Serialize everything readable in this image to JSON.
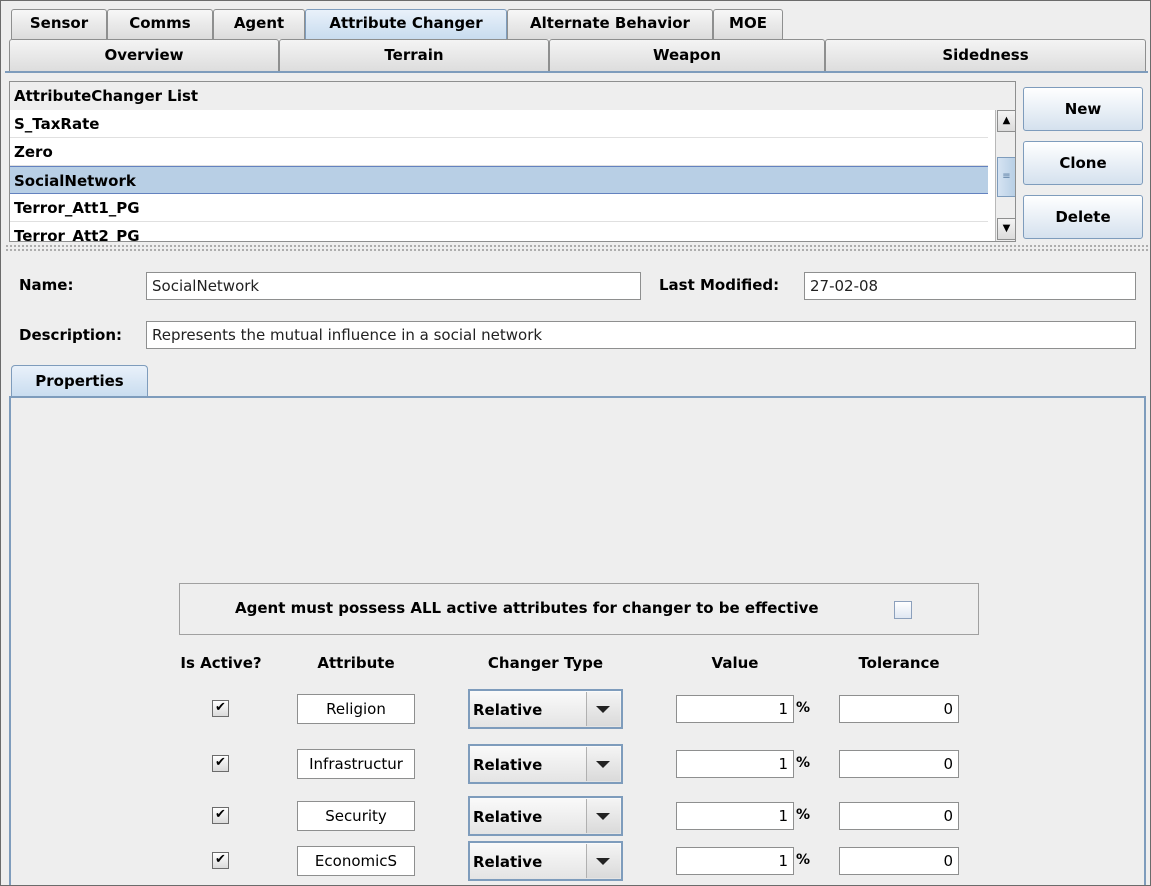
{
  "tabs_row1": [
    "Sensor",
    "Comms",
    "Agent",
    "Attribute Changer",
    "Alternate Behavior",
    "MOE"
  ],
  "tabs_row1_selected": "Attribute Changer",
  "tabs_row2": [
    "Overview",
    "Terrain",
    "Weapon",
    "Sidedness"
  ],
  "list": {
    "header": "AttributeChanger List",
    "items": [
      "S_TaxRate",
      "Zero",
      "SocialNetwork",
      "Terror_Att1_PG",
      "Terror_Att2_PG"
    ],
    "selected": "SocialNetwork"
  },
  "buttons": {
    "new": "New",
    "clone": "Clone",
    "delete": "Delete"
  },
  "form": {
    "name_label": "Name:",
    "name_value": "SocialNetwork",
    "last_modified_label": "Last Modified:",
    "last_modified_value": "27-02-08",
    "description_label": "Description:",
    "description_value": "Represents the mutual influence in a social network"
  },
  "properties_tab": "Properties",
  "all_attributes_text": "Agent must possess ALL active attributes for changer to be effective",
  "all_attributes_checked": false,
  "columns": {
    "is_active": "Is Active?",
    "attribute": "Attribute",
    "changer_type": "Changer Type",
    "value": "Value",
    "tolerance": "Tolerance"
  },
  "rows": [
    {
      "active": "✔",
      "attribute": "Religion",
      "changer_type": "Relative",
      "value": "1",
      "unit": "%",
      "tolerance": "0"
    },
    {
      "active": "✔",
      "attribute": "Infrastructur",
      "changer_type": "Relative",
      "value": "1",
      "unit": "%",
      "tolerance": "0"
    },
    {
      "active": "✔",
      "attribute": "Security",
      "changer_type": "Relative",
      "value": "1",
      "unit": "%",
      "tolerance": "0"
    },
    {
      "active": "✔",
      "attribute": "EconomicS",
      "changer_type": "Relative",
      "value": "1",
      "unit": "%",
      "tolerance": "0"
    }
  ],
  "colors": {
    "accent": "#7e9cbc",
    "selection": "#b8cfe5",
    "panel": "#eeeeee"
  },
  "icons": {
    "scroll_up": "arrow-up-icon",
    "scroll_down": "arrow-down-icon",
    "thumb": "grip-icon",
    "dropdown": "chevron-down-icon",
    "check": "checkmark-icon"
  }
}
